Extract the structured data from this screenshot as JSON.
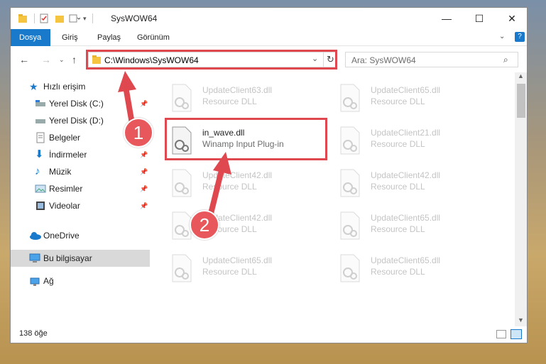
{
  "window": {
    "title": "SysWOW64",
    "controls": {
      "minimize": "—",
      "maximize": "☐",
      "close": "✕"
    }
  },
  "ribbon": {
    "tabs": [
      {
        "label": "Dosya",
        "active": true
      },
      {
        "label": "Giriş"
      },
      {
        "label": "Paylaş"
      },
      {
        "label": "Görünüm"
      }
    ]
  },
  "address": {
    "path": "C:\\Windows\\SysWOW64",
    "search_placeholder": "Ara: SysWOW64"
  },
  "sidebar": {
    "items": [
      {
        "label": "Hızlı erişim",
        "icon": "star-icon",
        "pinned": false
      },
      {
        "label": "Yerel Disk (C:)",
        "icon": "drive-icon",
        "pinned": true
      },
      {
        "label": "Yerel Disk (D:)",
        "icon": "drive-icon",
        "pinned": false
      },
      {
        "label": "Belgeler",
        "icon": "documents-icon",
        "pinned": true
      },
      {
        "label": "İndirmeler",
        "icon": "download-icon",
        "pinned": true
      },
      {
        "label": "Müzik",
        "icon": "music-icon",
        "pinned": true
      },
      {
        "label": "Resimler",
        "icon": "pictures-icon",
        "pinned": true
      },
      {
        "label": "Videolar",
        "icon": "video-icon",
        "pinned": true
      },
      {
        "label": "OneDrive",
        "icon": "cloud-icon",
        "pinned": false
      },
      {
        "label": "Bu bilgisayar",
        "icon": "computer-icon",
        "pinned": false,
        "selected": true
      },
      {
        "label": "Ağ",
        "icon": "network-icon",
        "pinned": false
      }
    ]
  },
  "files": [
    {
      "name": "UpdateClient63.dll",
      "type": "Resource DLL",
      "faded": true
    },
    {
      "name": "UpdateClient65.dll",
      "type": "Resource DLL",
      "faded": true
    },
    {
      "name": "in_wave.dll",
      "type": "Winamp Input Plug-in",
      "faded": false,
      "highlighted": true
    },
    {
      "name": "UpdateClient21.dll",
      "type": "Resource DLL",
      "faded": true
    },
    {
      "name": "UpdateClient42.dll",
      "type": "Resource DLL",
      "faded": true
    },
    {
      "name": "UpdateClient42.dll",
      "type": "Resource DLL",
      "faded": true
    },
    {
      "name": "UpdateClient42.dll",
      "type": "Resource DLL",
      "faded": true
    },
    {
      "name": "UpdateClient65.dll",
      "type": "Resource DLL",
      "faded": true
    },
    {
      "name": "UpdateClient65.dll",
      "type": "Resource DLL",
      "faded": true
    },
    {
      "name": "UpdateClient65.dll",
      "type": "Resource DLL",
      "faded": true
    }
  ],
  "status": {
    "item_count": "138 öğe"
  },
  "annotations": {
    "step1": "1",
    "step2": "2",
    "color": "#e0484f"
  }
}
